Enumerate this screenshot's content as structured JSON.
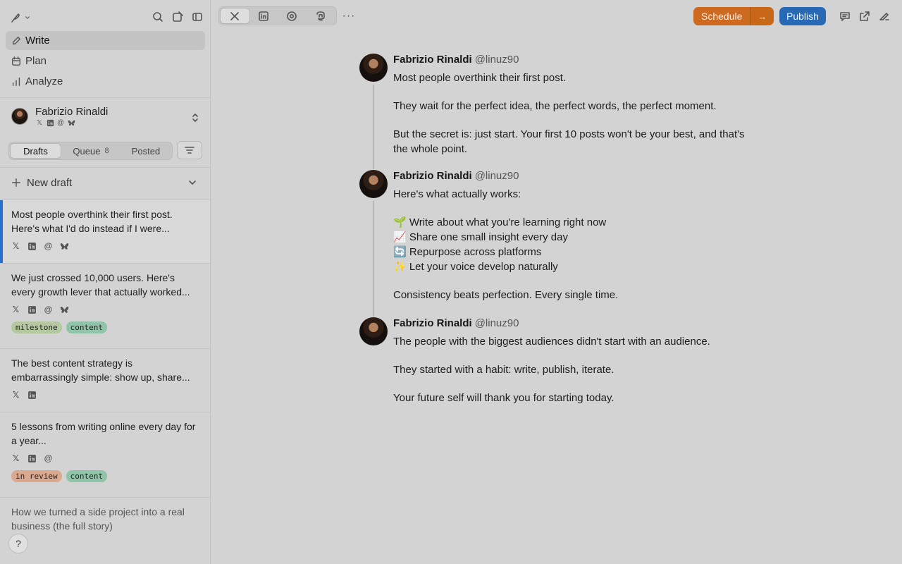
{
  "nav": {
    "items": [
      {
        "label": "Write",
        "icon": "pen-icon",
        "active": true
      },
      {
        "label": "Plan",
        "icon": "calendar-icon",
        "active": false
      },
      {
        "label": "Analyze",
        "icon": "bar-chart-icon",
        "active": false
      }
    ]
  },
  "account": {
    "name": "Fabrizio Rinaldi",
    "networks": [
      "x-icon",
      "linkedin-icon",
      "threads-icon",
      "bluesky-icon"
    ]
  },
  "tabs": {
    "drafts": "Drafts",
    "queue": "Queue",
    "queue_count": "8",
    "posted": "Posted"
  },
  "new_draft": "New draft",
  "drafts": [
    {
      "text": "Most people overthink their first post. Here's what I'd do instead if I were...",
      "networks": [
        "x",
        "linkedin",
        "threads",
        "bluesky"
      ],
      "tags": [],
      "selected": true
    },
    {
      "text": "We just crossed 10,000 users. Here's every growth lever that actually worked...",
      "networks": [
        "x",
        "linkedin",
        "threads",
        "bluesky"
      ],
      "tags": [
        {
          "label": "milestone",
          "color": "#b5c9a1"
        },
        {
          "label": "content",
          "color": "#8fc4a8"
        }
      ],
      "selected": false
    },
    {
      "text": "The best content strategy is embarrassingly simple: show up, share...",
      "networks": [
        "x",
        "linkedin"
      ],
      "tags": [],
      "selected": false
    },
    {
      "text": "5 lessons from writing online every day for a year...",
      "networks": [
        "x",
        "linkedin",
        "threads"
      ],
      "tags": [
        {
          "label": "in review",
          "color": "#dba98f"
        },
        {
          "label": "content",
          "color": "#8fc4a8"
        }
      ],
      "selected": false
    },
    {
      "text": "How we turned a side project into a real business (the full story)",
      "networks": [],
      "tags": [],
      "selected": false
    }
  ],
  "help": "?",
  "toolbar": {
    "platforms": [
      "x-icon",
      "linkedin-icon",
      "threads-icon",
      "mastodon-icon"
    ],
    "more": "···",
    "schedule": "Schedule",
    "schedule_arrow": "→",
    "publish": "Publish"
  },
  "colors": {
    "schedule": "#cd6a20",
    "publish": "#2769b4",
    "selected_accent": "#2a6fce"
  },
  "thread": {
    "author": "Fabrizio Rinaldi",
    "handle": "@linuz90",
    "posts": [
      {
        "paragraphs": [
          [
            "Most people overthink their first post."
          ],
          [
            "They wait for the perfect idea, the perfect words, the perfect moment."
          ],
          [
            "But the secret is: just start. Your first 10 posts won't be your best, and that's the whole point."
          ]
        ]
      },
      {
        "paragraphs": [
          [
            "Here's what actually works:"
          ],
          [
            "🌱 Write about what you're learning right now",
            "📈 Share one small insight every day",
            "🔄 Repurpose across platforms",
            "✨ Let your voice develop naturally"
          ],
          [
            "Consistency beats perfection. Every single time."
          ]
        ]
      },
      {
        "paragraphs": [
          [
            "The people with the biggest audiences didn't start with an audience."
          ],
          [
            "They started with a habit: write, publish, iterate."
          ],
          [
            "Your future self will thank you for starting today."
          ]
        ]
      }
    ]
  }
}
